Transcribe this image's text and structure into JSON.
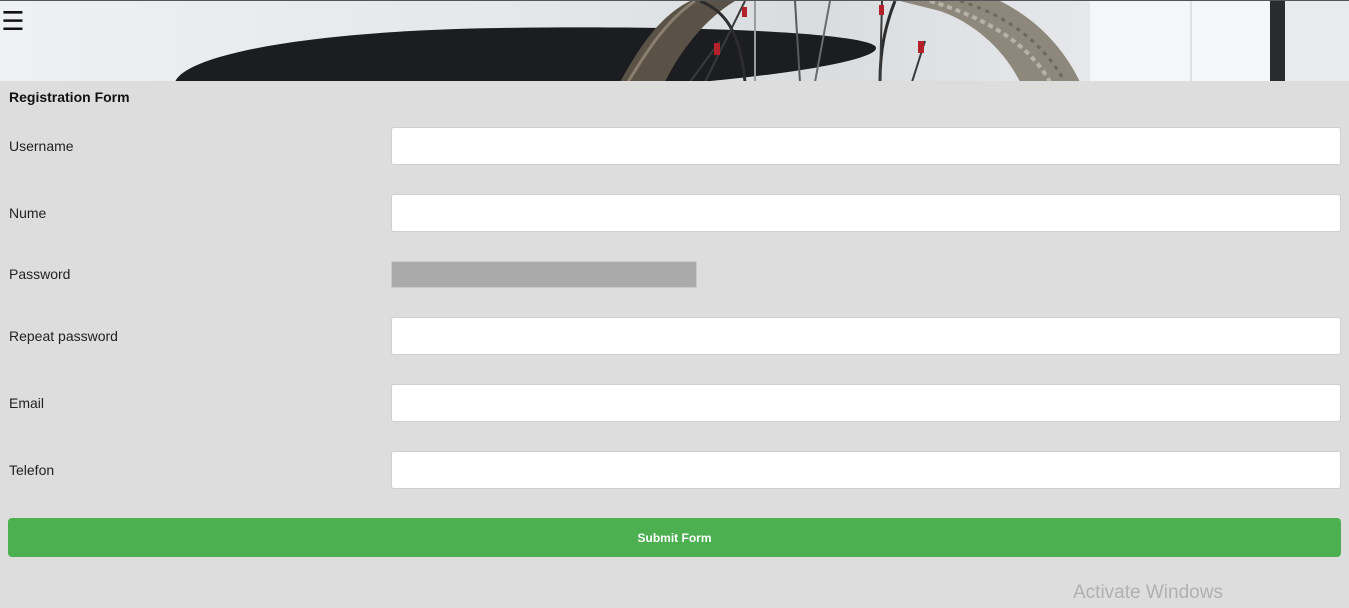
{
  "header": {
    "menu_icon": "hamburger-menu-icon",
    "menu_glyph": "☰"
  },
  "form": {
    "title": "Registration Form",
    "fields": [
      {
        "label": "Username",
        "value": "",
        "type": "text"
      },
      {
        "label": "Nume",
        "value": "",
        "type": "text"
      },
      {
        "label": "Password",
        "value": "",
        "type": "password"
      },
      {
        "label": "Repeat password",
        "value": "",
        "type": "text"
      },
      {
        "label": "Email",
        "value": "",
        "type": "text"
      },
      {
        "label": "Telefon",
        "value": "",
        "type": "text"
      }
    ],
    "submit_label": "Submit Form"
  },
  "os_watermark": {
    "text": "Activate Windows"
  },
  "colors": {
    "page_background": "#dddddd",
    "submit_button": "#4caf50",
    "password_field": "#aaaaaa",
    "input_background": "#ffffff"
  }
}
